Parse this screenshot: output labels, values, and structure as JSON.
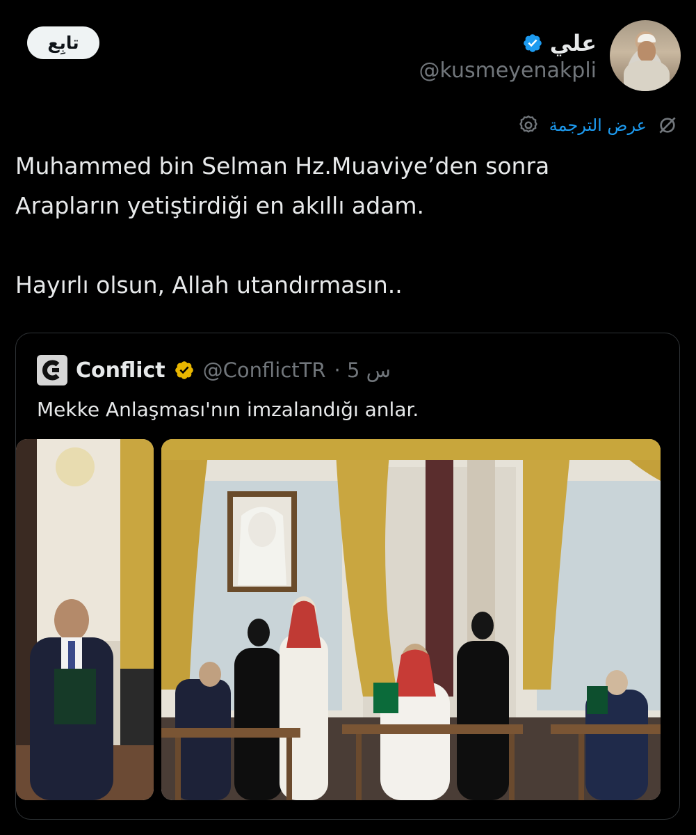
{
  "author": {
    "display_name": "علي",
    "handle": "@kusmeyenakpli",
    "verified": true,
    "avatar_icon": "user-avatar"
  },
  "follow_label": "تابِع",
  "translate": {
    "label": "عرض الترجمة",
    "icon": "translate-icon",
    "settings_icon": "gear-icon"
  },
  "tweet": {
    "line1": "Muhammed bin Selman Hz.Muaviye’den sonra",
    "line2": "Arapların yetiştirdiği en akıllı adam.",
    "line3": "Hayırlı olsun, Allah utandırmasın.."
  },
  "quote": {
    "name": "Conflict",
    "handle": "@ConflictTR",
    "time": "· 5 س",
    "text": "Mekke Anlaşması'nın imzalandığı anlar.",
    "badge_color": "#e8b600",
    "logo_icon": "conflict-logo-icon"
  },
  "colors": {
    "accent": "#1d9bf0",
    "background": "#000000",
    "muted": "#71767b"
  }
}
